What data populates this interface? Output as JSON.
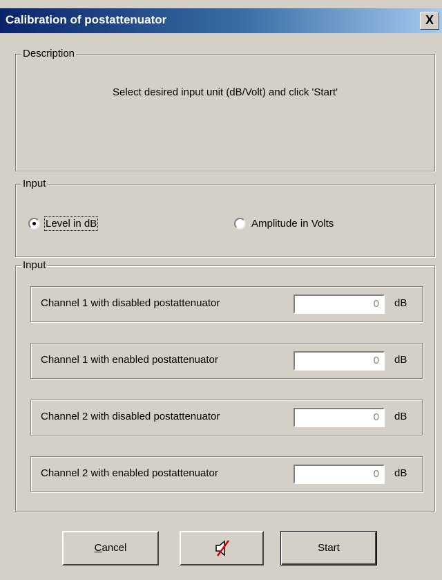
{
  "window": {
    "title": "Calibration of postattenuator",
    "close_label": "X"
  },
  "description": {
    "legend": "Description",
    "text": "Select desired input unit (dB/Volt) and click 'Start'"
  },
  "input_mode": {
    "legend": "Input",
    "options": [
      {
        "label": "Level in dB",
        "selected": true
      },
      {
        "label": "Amplitude in Volts",
        "selected": false
      }
    ]
  },
  "channels_group": {
    "legend": "Input",
    "channels": [
      {
        "label": "Channel 1 with disabled postattenuator",
        "value": "0",
        "unit": "dB"
      },
      {
        "label": "Channel 1 with enabled postattenuator",
        "value": "0",
        "unit": "dB"
      },
      {
        "label": "Channel 2 with disabled postattenuator",
        "value": "0",
        "unit": "dB"
      },
      {
        "label": "Channel 2 with enabled postattenuator",
        "value": "0",
        "unit": "dB"
      }
    ]
  },
  "buttons": {
    "cancel_rest": "ancel",
    "cancel_mnemonic": "C",
    "mute_icon": "speaker-muted-icon",
    "start": "Start"
  }
}
